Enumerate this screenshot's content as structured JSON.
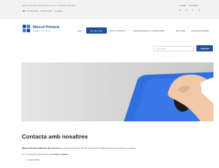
{
  "topbar": {
    "address": "Edifici Polivalent i Edifici Montseny, Av. Vallcarca, 189-193",
    "phone": "93 256 46 00 · 93 256 41 11",
    "contact_label": "Contacte",
    "languages": [
      "Català",
      "Castellano"
    ],
    "social_icons": [
      "linkedin-icon",
      "twitter-icon",
      "facebook-icon",
      "instagram-icon"
    ]
  },
  "logo": {
    "name": "Mancol Primària",
    "tagline": "Vallcarca · Bon Serveis"
  },
  "nav": {
    "items": [
      "INICI",
      "EL TEU CAP",
      "APTO I POKETS",
      "TRANSPARÈNCIA I COMPTANDS",
      "NOTÍCIES",
      "CONVOCATÒRIES"
    ],
    "active_index": 1
  },
  "search": {
    "placeholder": "Cerca aquí",
    "button_label": "CERCAR"
  },
  "content": {
    "title": "Contacta amb nosaltres",
    "line1_strong": "Mancol Primària Vallcarca-Bon Serveis",
    "line1_rest": " compta amb diversos vies de comunicació digitals obertes a les persones usuàries.",
    "line2_rest": "Per a consultes relacionades amb ",
    "line2_strong": "temes sanitaris",
    "link_label": "La Meva Salut"
  },
  "colors": {
    "brand": "#1e4f9a",
    "accent": "#3f7fcf",
    "topbar_bg": "#f2f2f2"
  }
}
